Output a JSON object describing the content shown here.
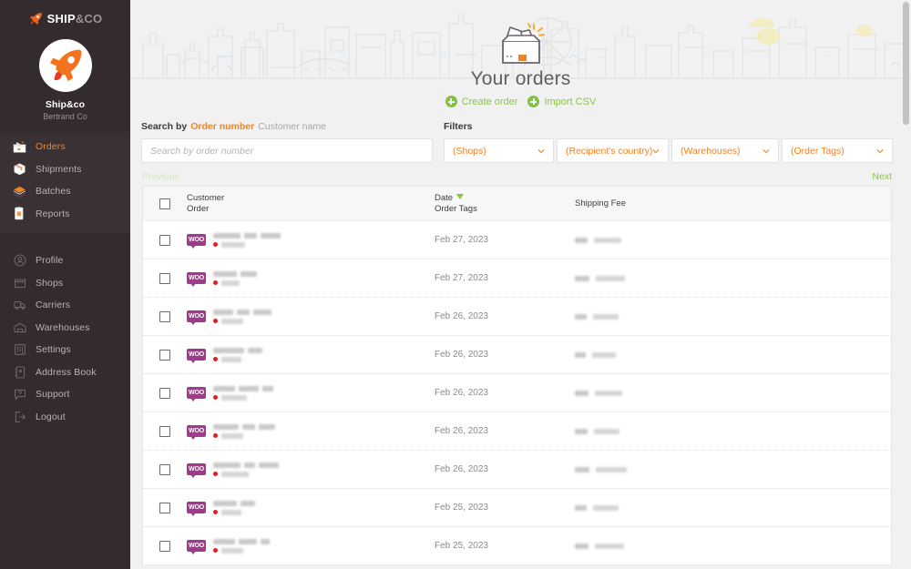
{
  "brand": {
    "logo_text_1": "SHIP",
    "logo_text_2": "&CO",
    "logo_icon": "rocket-icon"
  },
  "account": {
    "name": "Ship&co",
    "company": "Bertrand Co",
    "avatar_icon": "rocket-avatar-icon"
  },
  "sidebar": {
    "primary_items": [
      {
        "label": "Orders",
        "icon": "orders-box-icon",
        "active": true
      },
      {
        "label": "Shipments",
        "icon": "shipments-package-icon",
        "active": false
      },
      {
        "label": "Batches",
        "icon": "batches-stack-icon",
        "active": false
      },
      {
        "label": "Reports",
        "icon": "reports-clipboard-icon",
        "active": false
      }
    ],
    "secondary_items": [
      {
        "label": "Profile",
        "icon": "profile-icon"
      },
      {
        "label": "Shops",
        "icon": "shop-icon"
      },
      {
        "label": "Carriers",
        "icon": "truck-icon"
      },
      {
        "label": "Warehouses",
        "icon": "warehouse-icon"
      },
      {
        "label": "Settings",
        "icon": "sliders-icon"
      },
      {
        "label": "Address Book",
        "icon": "address-book-icon"
      },
      {
        "label": "Support",
        "icon": "question-bubble-icon"
      },
      {
        "label": "Logout",
        "icon": "logout-icon"
      }
    ]
  },
  "hero": {
    "title": "Your orders",
    "illustration_icon": "open-box-icon",
    "actions": [
      {
        "label": "Create order",
        "icon": "plus-circle-icon"
      },
      {
        "label": "Import CSV",
        "icon": "plus-circle-icon"
      }
    ]
  },
  "search": {
    "label": "Search by",
    "tab_active": "Order number",
    "tab_inactive": "Customer name",
    "placeholder": "Search by order number",
    "value": ""
  },
  "filters": {
    "label": "Filters",
    "selects": [
      {
        "label": "(Shops)",
        "icon": "chevron-down-icon"
      },
      {
        "label": "(Recipient's country)",
        "icon": "chevron-down-icon"
      },
      {
        "label": "(Warehouses)",
        "icon": "chevron-down-icon"
      },
      {
        "label": "(Order Tags)",
        "icon": "chevron-down-icon"
      }
    ]
  },
  "pagination": {
    "previous": "Previous",
    "next": "Next",
    "previous_disabled": true
  },
  "table": {
    "headers": {
      "customer": "Customer",
      "order": "Order",
      "date": "Date",
      "order_tags": "Order Tags",
      "shipping_fee": "Shipping Fee",
      "sort_icon": "sort-descending-caret"
    },
    "rows": [
      {
        "shop_badge": "WOO",
        "date": "Feb 27, 2023",
        "customer_redacted": true,
        "order_redacted": true,
        "fee_redacted": true
      },
      {
        "shop_badge": "WOO",
        "date": "Feb 27, 2023",
        "customer_redacted": true,
        "order_redacted": true,
        "fee_redacted": true
      },
      {
        "shop_badge": "WOO",
        "date": "Feb 26, 2023",
        "customer_redacted": true,
        "order_redacted": true,
        "fee_redacted": true
      },
      {
        "shop_badge": "WOO",
        "date": "Feb 26, 2023",
        "customer_redacted": true,
        "order_redacted": true,
        "fee_redacted": true
      },
      {
        "shop_badge": "WOO",
        "date": "Feb 26, 2023",
        "customer_redacted": true,
        "order_redacted": true,
        "fee_redacted": true
      },
      {
        "shop_badge": "WOO",
        "date": "Feb 26, 2023",
        "customer_redacted": true,
        "order_redacted": true,
        "fee_redacted": true
      },
      {
        "shop_badge": "WOO",
        "date": "Feb 26, 2023",
        "customer_redacted": true,
        "order_redacted": true,
        "fee_redacted": true
      },
      {
        "shop_badge": "WOO",
        "date": "Feb 25, 2023",
        "customer_redacted": true,
        "order_redacted": true,
        "fee_redacted": true
      },
      {
        "shop_badge": "WOO",
        "date": "Feb 25, 2023",
        "customer_redacted": true,
        "order_redacted": true,
        "fee_redacted": true
      }
    ]
  },
  "colors": {
    "sidebar_bg": "#332b2e",
    "sidebar_active_text": "#f08326",
    "accent_orange": "#f08326",
    "accent_green": "#8dc63f",
    "page_bg": "#f1f1f1",
    "woo_badge": "#a03a8c",
    "status_dot_red": "#e02020"
  }
}
